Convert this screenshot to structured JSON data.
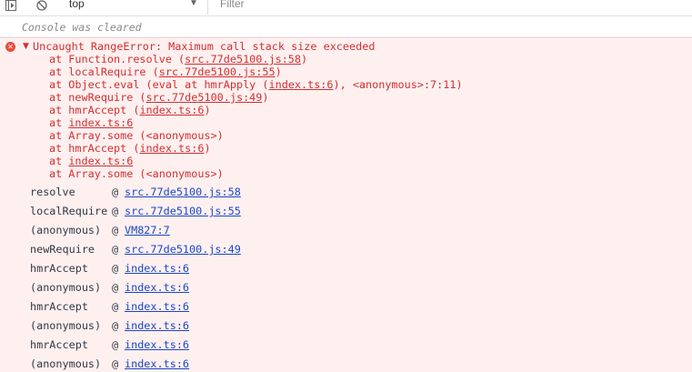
{
  "toolbar": {
    "context": "top",
    "filter_placeholder": "Filter"
  },
  "console": {
    "cleared_message": "Console was cleared",
    "error": {
      "header": "Uncaught RangeError: Maximum call stack size exceeded",
      "stack": [
        {
          "prefix": "at Function.resolve (",
          "link": "src.77de5100.js:58",
          "suffix": ")"
        },
        {
          "prefix": "at localRequire (",
          "link": "src.77de5100.js:55",
          "suffix": ")"
        },
        {
          "prefix": "at Object.eval (eval at hmrApply (",
          "link": "index.ts:6",
          "suffix": "), <anonymous>:7:11)"
        },
        {
          "prefix": "at newRequire (",
          "link": "src.77de5100.js:49",
          "suffix": ")"
        },
        {
          "prefix": "at hmrAccept (",
          "link": "index.ts:6",
          "suffix": ")"
        },
        {
          "prefix": "at ",
          "link": "index.ts:6",
          "suffix": ""
        },
        {
          "prefix": "at Array.some (<anonymous>)",
          "link": "",
          "suffix": ""
        },
        {
          "prefix": "at hmrAccept (",
          "link": "index.ts:6",
          "suffix": ")"
        },
        {
          "prefix": "at ",
          "link": "index.ts:6",
          "suffix": ""
        },
        {
          "prefix": "at Array.some (<anonymous>)",
          "link": "",
          "suffix": ""
        }
      ],
      "call_frames": [
        {
          "fn": "resolve",
          "at": "@",
          "link": "src.77de5100.js:58"
        },
        {
          "fn": "localRequire",
          "at": "@",
          "link": "src.77de5100.js:55"
        },
        {
          "fn": "(anonymous)",
          "at": "@",
          "link": "VM827:7"
        },
        {
          "fn": "newRequire",
          "at": "@",
          "link": "src.77de5100.js:49"
        },
        {
          "fn": "hmrAccept",
          "at": "@",
          "link": "index.ts:6"
        },
        {
          "fn": "(anonymous)",
          "at": "@",
          "link": "index.ts:6"
        },
        {
          "fn": "hmrAccept",
          "at": "@",
          "link": "index.ts:6"
        },
        {
          "fn": "(anonymous)",
          "at": "@",
          "link": "index.ts:6"
        },
        {
          "fn": "hmrAccept",
          "at": "@",
          "link": "index.ts:6"
        },
        {
          "fn": "(anonymous)",
          "at": "@",
          "link": "index.ts:6"
        }
      ]
    }
  },
  "colors": {
    "error_text": "#d32f2f",
    "error_bg": "#fff0f0",
    "link": "#1a47c8"
  },
  "icons": [
    "sidebar-toggle-icon",
    "clear-console-icon",
    "chevron-down-icon",
    "error-icon",
    "expand-triangle-icon"
  ]
}
